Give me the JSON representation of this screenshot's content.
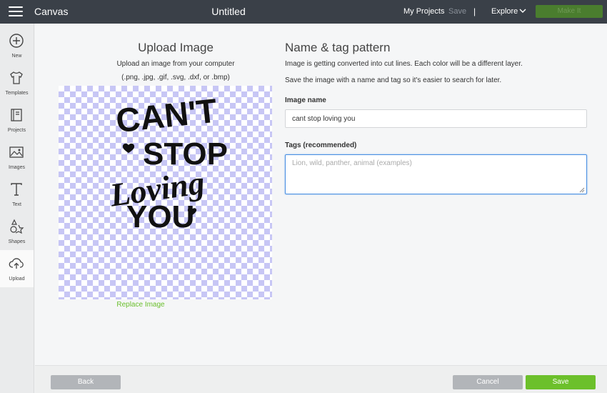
{
  "topbar": {
    "app_title": "Canvas",
    "doc_title": "Untitled",
    "my_projects": "My Projects",
    "save": "Save",
    "divider": "|",
    "explore": "Explore",
    "make_it": "Make It"
  },
  "sidebar": {
    "items": [
      {
        "label": "New",
        "icon": "plus-circle-icon"
      },
      {
        "label": "Templates",
        "icon": "tshirt-icon"
      },
      {
        "label": "Projects",
        "icon": "book-icon"
      },
      {
        "label": "Images",
        "icon": "image-icon"
      },
      {
        "label": "Text",
        "icon": "text-t-icon"
      },
      {
        "label": "Shapes",
        "icon": "shapes-icon"
      },
      {
        "label": "Upload",
        "icon": "cloud-upload-icon"
      }
    ]
  },
  "upload": {
    "title": "Upload Image",
    "description": "Upload an image from your computer",
    "formats": "(.png, .jpg, .gif, .svg, .dxf, or .bmp)",
    "artwork_lines": [
      "CAN'T",
      "STOP",
      "Loving",
      "YOU"
    ],
    "replace_label": "Replace Image"
  },
  "form": {
    "title": "Name & tag pattern",
    "desc1": "Image is getting converted into cut lines. Each color will be a different layer.",
    "desc2": "Save the image with a name and tag so it's easier to search for later.",
    "name_label": "Image name",
    "name_value": "cant stop loving you",
    "tags_label": "Tags (recommended)",
    "tags_placeholder": "Lion, wild, panther, animal (examples)"
  },
  "footer": {
    "back": "Back",
    "cancel": "Cancel",
    "save": "Save"
  },
  "colors": {
    "topbar": "#3a4048",
    "accent_green": "#6cc02b",
    "checker": "#c7c6f5",
    "focus_blue": "#4a90e2"
  }
}
